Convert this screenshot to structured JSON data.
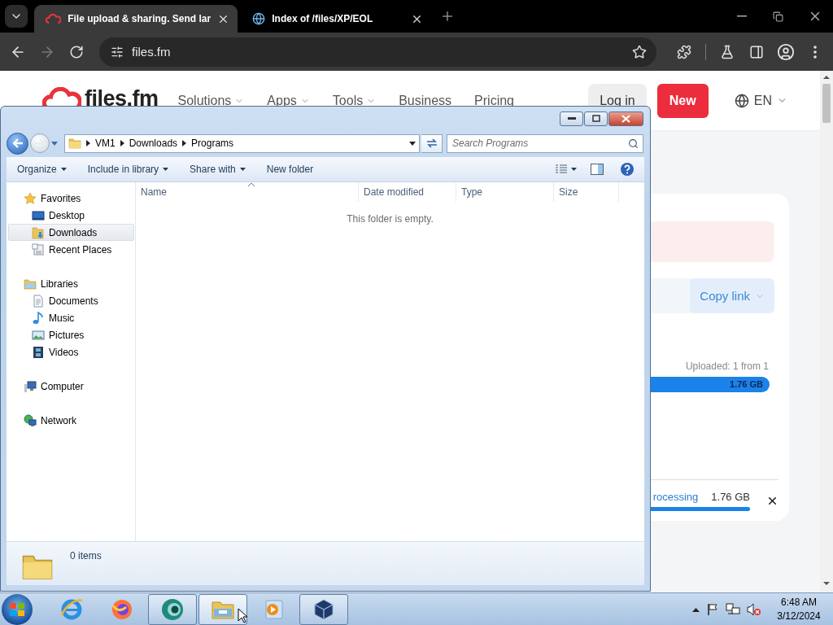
{
  "browser": {
    "tabs": [
      {
        "title": "File upload & sharing. Send lar",
        "selected": true,
        "kind": "cloud"
      },
      {
        "title": "Index of /files/XP/EOL",
        "selected": false,
        "kind": "globe"
      }
    ],
    "address": "files.fm"
  },
  "site": {
    "logo": "files.fm",
    "nav": [
      {
        "label": "Solutions",
        "menu": true
      },
      {
        "label": "Apps",
        "menu": true
      },
      {
        "label": "Tools",
        "menu": true
      },
      {
        "label": "Business",
        "menu": false
      },
      {
        "label": "Pricing",
        "menu": false
      }
    ],
    "login": "Log in",
    "new": "New",
    "language": "EN"
  },
  "upload_card": {
    "copy_link": "Copy link",
    "uploaded": "Uploaded: 1 from 1",
    "progress": {
      "level": 1,
      "label": "1.76 GB"
    },
    "processing": {
      "status": "rocessing",
      "size": "1.76 GB",
      "level": 1
    }
  },
  "explorer": {
    "breadcrumb": [
      "VM1",
      "Downloads",
      "Programs"
    ],
    "search_placeholder": "Search Programs",
    "commands": [
      {
        "label": "Organize",
        "menu": true
      },
      {
        "label": "Include in library",
        "menu": true
      },
      {
        "label": "Share with",
        "menu": true
      },
      {
        "label": "New folder",
        "menu": false
      }
    ],
    "nav": [
      {
        "label": "Favorites",
        "kind": "favorites",
        "selected": false,
        "children": [
          {
            "label": "Desktop",
            "kind": "desktop",
            "selected": false
          },
          {
            "label": "Downloads",
            "kind": "downloads",
            "selected": true
          },
          {
            "label": "Recent Places",
            "kind": "recent",
            "selected": false
          }
        ]
      },
      {
        "label": "Libraries",
        "kind": "libraries",
        "selected": false,
        "children": [
          {
            "label": "Documents",
            "kind": "documents",
            "selected": false
          },
          {
            "label": "Music",
            "kind": "music",
            "selected": false
          },
          {
            "label": "Pictures",
            "kind": "pictures",
            "selected": false
          },
          {
            "label": "Videos",
            "kind": "videos",
            "selected": false
          }
        ]
      },
      {
        "label": "Computer",
        "kind": "computer",
        "selected": false
      },
      {
        "label": "Network",
        "kind": "network",
        "selected": false
      }
    ],
    "columns": [
      "Name",
      "Date modified",
      "Type",
      "Size"
    ],
    "empty_text": "This folder is empty.",
    "status": "0 items"
  },
  "taskbar": {
    "apps": [
      {
        "kind": "ie",
        "running": false,
        "selected": false
      },
      {
        "kind": "firefox",
        "running": false,
        "selected": false
      },
      {
        "kind": "sphere",
        "running": true,
        "selected": false
      },
      {
        "kind": "explorer",
        "running": true,
        "selected": true
      },
      {
        "kind": "media",
        "running": false,
        "selected": false
      },
      {
        "kind": "virtualbox",
        "running": true,
        "selected": false
      }
    ],
    "clock": {
      "time": "6:48 AM",
      "date": "3/12/2024"
    }
  }
}
